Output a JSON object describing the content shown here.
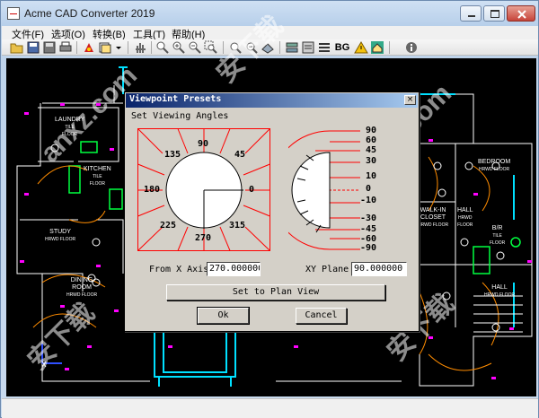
{
  "app": {
    "title": "Acme CAD Converter 2019"
  },
  "menu": [
    "文件(F)",
    "选项(O)",
    "转换(B)",
    "工具(T)",
    "帮助(H)"
  ],
  "toolbar": {
    "bg_label": "BG"
  },
  "floorplan": {
    "rooms": [
      {
        "name": "LAUNDRY",
        "sub": "TILE\nFLOOR"
      },
      {
        "name": "KITCHEN",
        "sub": "TILE\nFLOOR"
      },
      {
        "name": "STUDY",
        "sub": "HRWD FLOOR"
      },
      {
        "name": "DINING\nROOM",
        "sub": "HRWD FLOOR"
      },
      {
        "name": "BEDROOM",
        "sub": "HRWD FLOOR"
      },
      {
        "name": "WALK-IN\nCLOSET",
        "sub": "HRWD FLOOR"
      },
      {
        "name": "HALL",
        "sub": "HRWD\nFLOOR"
      },
      {
        "name": "B/R",
        "sub": "TILE\nFLOOR"
      },
      {
        "name": "HALL",
        "sub": "HRWD FLOOR"
      }
    ]
  },
  "dialog": {
    "title": "Viewpoint Presets",
    "subtitle": "Set Viewing Angles",
    "left_angles": [
      "90",
      "135",
      "45",
      "180",
      "0",
      "225",
      "315",
      "270"
    ],
    "right_angles": [
      "90",
      "60",
      "45",
      "30",
      "10",
      "0",
      "-10",
      "-30",
      "-45",
      "-60",
      "-90"
    ],
    "from_x_label": "From X Axis",
    "from_x_value": "270.000000",
    "xy_plane_label": "XY Plane",
    "xy_plane_value": "90.000000",
    "plan_view_label": "Set to Plan View",
    "ok_label": "Ok",
    "cancel_label": "Cancel",
    "close_glyph": "×"
  },
  "watermark": {
    "text1": "anxz.com",
    "text2": "安下载"
  },
  "colors": {
    "accent": "#ff0000",
    "canvas": "#000000",
    "titlebar_start": "#0a246a"
  }
}
